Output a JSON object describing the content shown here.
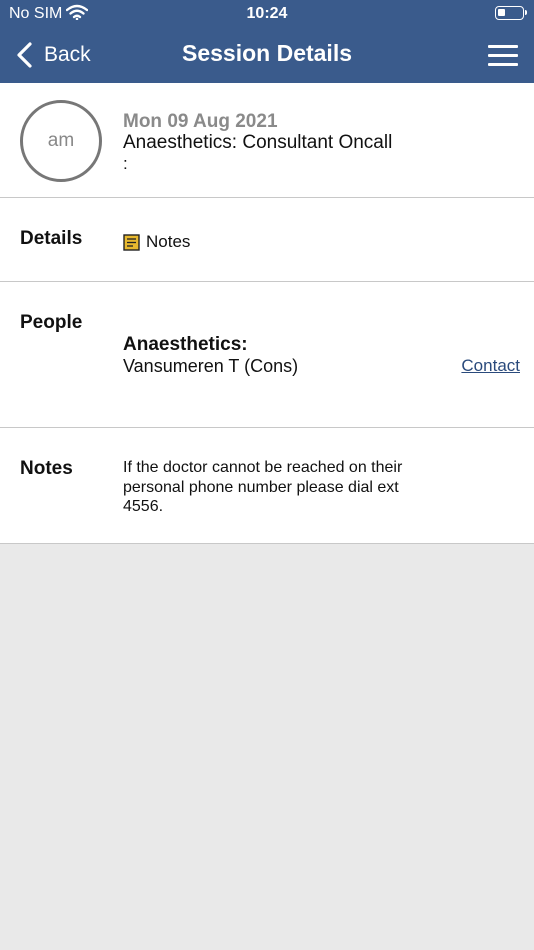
{
  "status_bar": {
    "carrier": "No SIM",
    "time": "10:24",
    "battery_level": 0.3
  },
  "nav": {
    "back_label": "Back",
    "title": "Session Details",
    "menu_icon": "hamburger-menu-icon"
  },
  "session": {
    "avatar_text": "am",
    "date": "Mon 09 Aug 2021",
    "title": "Anaesthetics: Consultant Oncall",
    "subtitle": ":"
  },
  "details": {
    "label": "Details",
    "notes_link_label": "Notes",
    "notes_icon": "note-icon"
  },
  "people": {
    "label": "People",
    "groups": [
      {
        "role": "Anaesthetics:",
        "name": "Vansumeren T (Cons)",
        "contact_label": "Contact"
      }
    ]
  },
  "notes": {
    "label": "Notes",
    "text": "If the doctor cannot be reached on their personal phone number please dial ext 4556."
  },
  "colors": {
    "header": "#3a5b8c",
    "note_icon": "#e8b92e",
    "link": "#2a4a7c"
  }
}
